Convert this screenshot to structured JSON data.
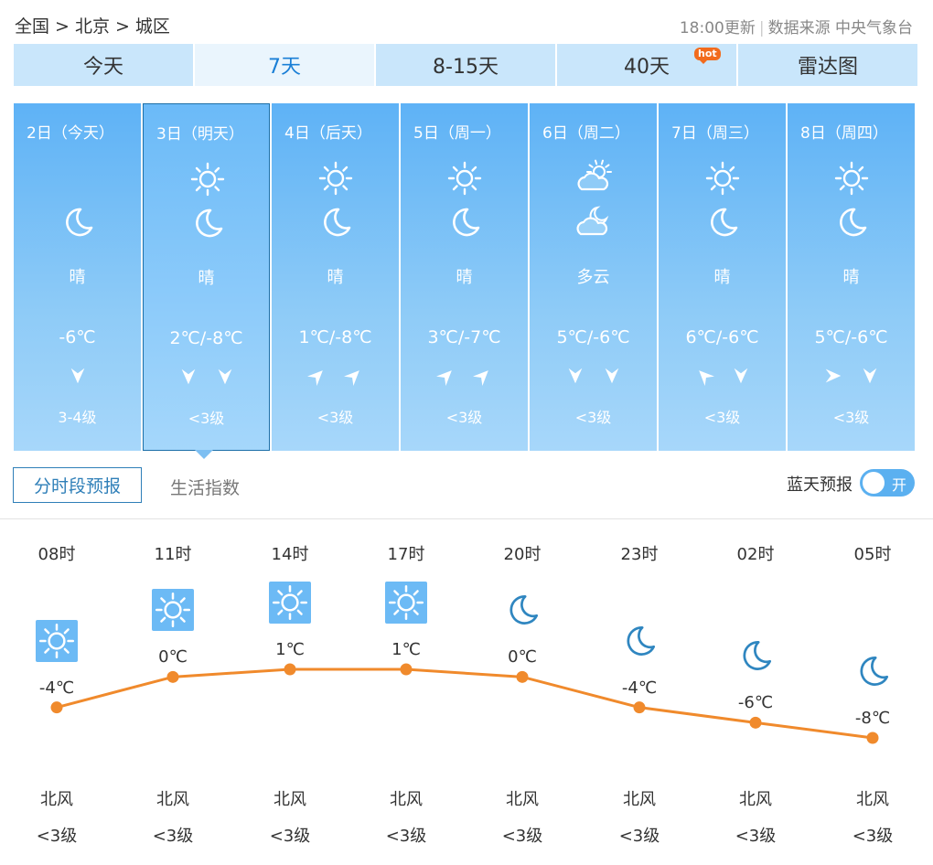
{
  "breadcrumb": {
    "items": [
      "全国",
      "北京",
      "城区"
    ],
    "sep": ">"
  },
  "update": {
    "time": "18:00更新",
    "source": "数据来源 中央气象台"
  },
  "tabs": [
    {
      "label": "今天",
      "active": false
    },
    {
      "label": "7天",
      "active": true
    },
    {
      "label": "8-15天",
      "active": false
    },
    {
      "label": "40天",
      "active": false,
      "badge": "hot"
    },
    {
      "label": "雷达图",
      "active": false
    }
  ],
  "days": [
    {
      "date": "2日（今天）",
      "icons": [
        "moon"
      ],
      "weather": "晴",
      "temp": "-6℃",
      "winds": [
        "down"
      ],
      "level": "3-4级"
    },
    {
      "date": "3日（明天）",
      "icons": [
        "sun",
        "moon"
      ],
      "weather": "晴",
      "temp": "2℃/-8℃",
      "winds": [
        "down",
        "down"
      ],
      "level": "<3级",
      "selected": true
    },
    {
      "date": "4日（后天）",
      "icons": [
        "sun",
        "moon"
      ],
      "weather": "晴",
      "temp": "1℃/-8℃",
      "winds": [
        "ne",
        "ne"
      ],
      "level": "<3级"
    },
    {
      "date": "5日（周一）",
      "icons": [
        "sun",
        "moon"
      ],
      "weather": "晴",
      "temp": "3℃/-7℃",
      "winds": [
        "ne",
        "ne"
      ],
      "level": "<3级"
    },
    {
      "date": "6日（周二）",
      "icons": [
        "cloud-sun",
        "cloud-moon"
      ],
      "weather": "多云",
      "temp": "5℃/-6℃",
      "winds": [
        "down",
        "down"
      ],
      "level": "<3级"
    },
    {
      "date": "7日（周三）",
      "icons": [
        "sun",
        "moon"
      ],
      "weather": "晴",
      "temp": "6℃/-6℃",
      "winds": [
        "se",
        "down"
      ],
      "level": "<3级"
    },
    {
      "date": "8日（周四）",
      "icons": [
        "sun",
        "moon"
      ],
      "weather": "晴",
      "temp": "5℃/-6℃",
      "winds": [
        "right",
        "down"
      ],
      "level": "<3级"
    }
  ],
  "subtabs": {
    "hourly": "分时段预报",
    "life": "生活指数"
  },
  "bluesky": {
    "label": "蓝天预报",
    "toggle": "开"
  },
  "hourly": [
    {
      "time": "08时",
      "icon": "sun",
      "temp": -4,
      "temp_label": "-4℃",
      "wind": "北风",
      "level": "<3级"
    },
    {
      "time": "11时",
      "icon": "sun",
      "temp": 0,
      "temp_label": "0℃",
      "wind": "北风",
      "level": "<3级"
    },
    {
      "time": "14时",
      "icon": "sun",
      "temp": 1,
      "temp_label": "1℃",
      "wind": "北风",
      "level": "<3级"
    },
    {
      "time": "17时",
      "icon": "sun",
      "temp": 1,
      "temp_label": "1℃",
      "wind": "北风",
      "level": "<3级"
    },
    {
      "time": "20时",
      "icon": "moon",
      "temp": 0,
      "temp_label": "0℃",
      "wind": "北风",
      "level": "<3级"
    },
    {
      "time": "23时",
      "icon": "moon",
      "temp": -4,
      "temp_label": "-4℃",
      "wind": "北风",
      "level": "<3级"
    },
    {
      "time": "02时",
      "icon": "moon",
      "temp": -6,
      "temp_label": "-6℃",
      "wind": "北风",
      "level": "<3级"
    },
    {
      "time": "05时",
      "icon": "moon",
      "temp": -8,
      "temp_label": "-8℃",
      "wind": "北风",
      "level": "<3级"
    }
  ],
  "colors": {
    "accent": "#1a7fd6",
    "curve": "#f08a2c",
    "tab_bg": "#c9e6fb",
    "day_top": "#5eb2f6",
    "day_bottom": "#a7d7fa"
  }
}
